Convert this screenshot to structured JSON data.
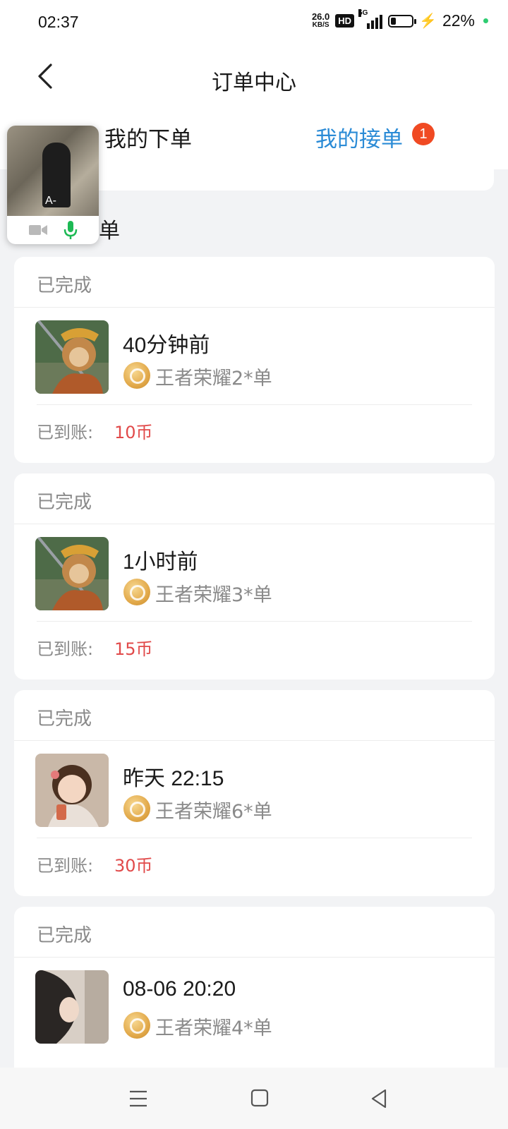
{
  "status_bar": {
    "time": "02:37",
    "net_speed_value": "26.0",
    "net_speed_unit": "KB/S",
    "hd_label": "HD",
    "network_label": "5G",
    "battery_percent": "22%",
    "battery_level": 0.22
  },
  "header": {
    "title": "订单中心",
    "tabs": [
      {
        "label": "我的下单",
        "active": false
      },
      {
        "label": "我的接单",
        "active": true,
        "badge": "1"
      }
    ]
  },
  "section_fragment": "单",
  "floating_call": {
    "overlay_text": "A-"
  },
  "orders": [
    {
      "status": "已完成",
      "time": "40分钟前",
      "game_line": "王者荣耀2*单",
      "payout_label": "已到账:",
      "payout_value": "10币",
      "avatar": "monkey-king-avatar"
    },
    {
      "status": "已完成",
      "time": "1小时前",
      "game_line": "王者荣耀3*单",
      "payout_label": "已到账:",
      "payout_value": "15币",
      "avatar": "monkey-king-avatar"
    },
    {
      "status": "已完成",
      "time": "昨天 22:15",
      "game_line": "王者荣耀6*单",
      "payout_label": "已到账:",
      "payout_value": "30币",
      "avatar": "girl-avatar"
    },
    {
      "status": "已完成",
      "time": "08-06 20:20",
      "game_line": "王者荣耀4*单",
      "avatar": "woman-avatar"
    }
  ],
  "colors": {
    "accent": "#2b8bd6",
    "badge": "#f04a23",
    "payout": "#e14a4a",
    "background": "#f2f3f5"
  }
}
